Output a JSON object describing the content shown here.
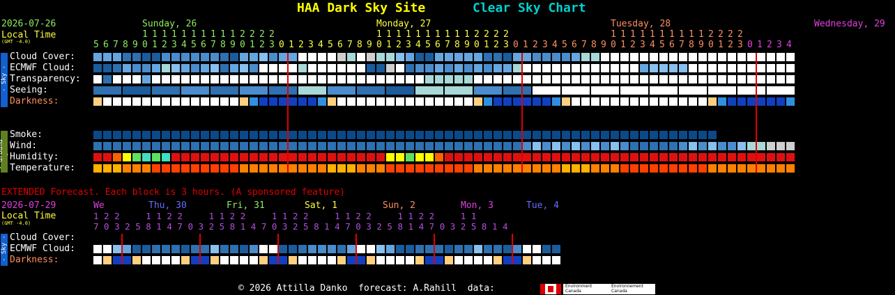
{
  "header": {
    "site": "HAA Dark Sky Site",
    "chart": "Clear Sky Chart"
  },
  "main": {
    "date": "2026-07-26",
    "local_time": "Local Time",
    "gmt": "(GMT -4.0)",
    "days": [
      {
        "label": "Sunday, 26",
        "color": "#90ee60"
      },
      {
        "label": "Monday, 27",
        "color": "#ffff40"
      },
      {
        "label": "Tuesday, 28",
        "color": "#ff9060"
      },
      {
        "label": "Wednesday, 29",
        "color": "#e040e0"
      }
    ],
    "hours_start": 5,
    "hours_count": 72,
    "rows_sky": [
      {
        "label": "Cloud Cover:"
      },
      {
        "label": "ECMWF Cloud:"
      },
      {
        "label": "Transparency:"
      },
      {
        "label": "Seeing:"
      },
      {
        "label": "Darkness:"
      }
    ],
    "rows_ground": [
      {
        "label": "Smoke:"
      },
      {
        "label": "Wind:"
      },
      {
        "label": "Humidity:"
      },
      {
        "label": "Temperature:"
      }
    ],
    "side_sky": "- Sky -",
    "side_ground": "- Ground -"
  },
  "extended": {
    "note": "EXTENDED Forecast. Each block is 3 hours. (A sponsored feature)",
    "date": "2026-07-29",
    "local_time": "Local Time",
    "gmt": "(GMT -4.0)",
    "days": [
      {
        "label": "We",
        "color": "#e040e0"
      },
      {
        "label": "Thu, 30",
        "color": "#6a6aff"
      },
      {
        "label": "Fri, 31",
        "color": "#90ee60"
      },
      {
        "label": "Sat, 1",
        "color": "#ffff40"
      },
      {
        "label": "Sun, 2",
        "color": "#ff9060"
      },
      {
        "label": "Mon, 3",
        "color": "#e040e0"
      },
      {
        "label": "Tue, 4",
        "color": "#6a6aff"
      }
    ],
    "hours_tens": "1 2 2     1 1 2 2     1 1 2 2     1 1 2 2     1 1 2 2     1 1 2 2     1 1",
    "hours_ones": "7 0 3 2 5 8 1 4 7 0 3 2 5 8 1 4 7 0 3 2 5 8 1 4 7 0 3 2 5 8 1 4 7 0 3 2 5 8 1 4",
    "rows": [
      {
        "label": "Cloud Cover:"
      },
      {
        "label": "ECMWF Cloud:"
      },
      {
        "label": "Darkness:"
      }
    ],
    "side_sky": "- Sky -"
  },
  "footer": {
    "text": "© 2026 Attilla Danko  forecast: A.Rahill  data:",
    "env1": "Environment\nCanada",
    "env2": "Environnement\nCanada"
  },
  "colors": {
    "title_site": "#ffff00",
    "title_chart": "#00d0d0",
    "label": "#ffffff",
    "darkness_label": "#ff9060",
    "extended_note": "#e00000",
    "midnight_line": "#e00000",
    "overcast": "#ffffff",
    "clear": "#0a4a8a"
  }
}
